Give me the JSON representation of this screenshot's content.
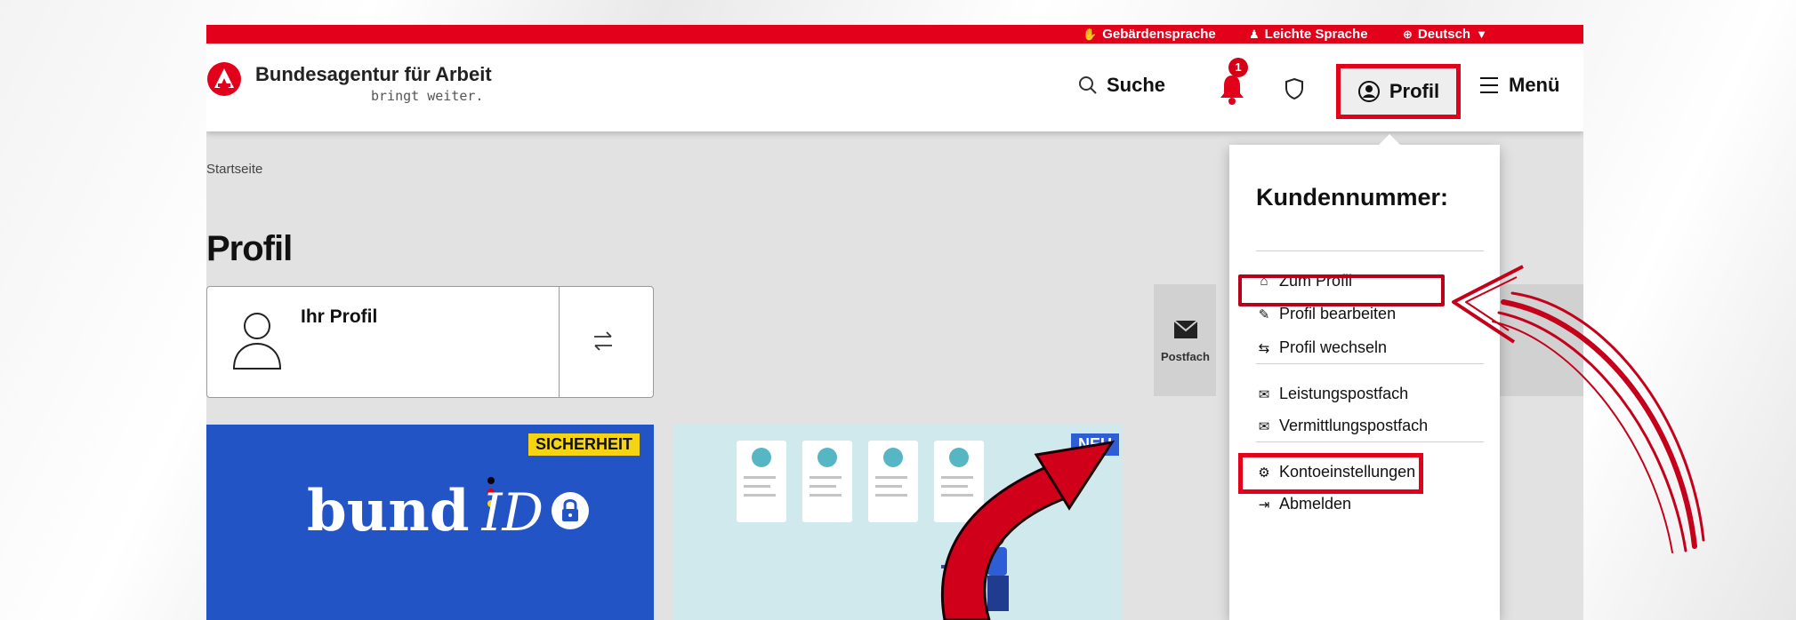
{
  "topbar": {
    "sign_language": "Gebärdensprache",
    "easy_language": "Leichte Sprache",
    "language": "Deutsch"
  },
  "header": {
    "brand_name": "Bundesagentur für Arbeit",
    "brand_claim": "bringt weiter.",
    "search_label": "Suche",
    "notification_count": "1",
    "profile_label": "Profil",
    "menu_label": "Menü"
  },
  "main": {
    "breadcrumb": "Startseite",
    "title": "Profil",
    "profile_card_label": "Ihr Profil",
    "postfach_label": "Postfach",
    "cards": [
      {
        "tag": "SICHERHEIT",
        "logo_text": "bund",
        "logo_italic": "ID"
      },
      {
        "tag": "NEU"
      }
    ]
  },
  "dropdown": {
    "customer_number_label": "Kundennummer:",
    "items": [
      {
        "label": "Zum Profil",
        "icon": "home-icon"
      },
      {
        "label": "Profil bearbeiten",
        "icon": "pencil-icon"
      },
      {
        "label": "Profil wechseln",
        "icon": "switch-arrows-icon"
      },
      {
        "label": "Leistungspostfach",
        "icon": "envelope-icon"
      },
      {
        "label": "Vermittlungspostfach",
        "icon": "envelope-icon"
      },
      {
        "label": "Kontoeinstellungen",
        "icon": "gear-icon"
      },
      {
        "label": "Abmelden",
        "icon": "logout-icon"
      }
    ]
  },
  "colors": {
    "brand_red": "#e3001b",
    "highlight_red": "#e3001b",
    "bund_blue": "#2354c5",
    "security_yellow": "#f6d313",
    "new_badge_blue": "#2e5ed6"
  }
}
